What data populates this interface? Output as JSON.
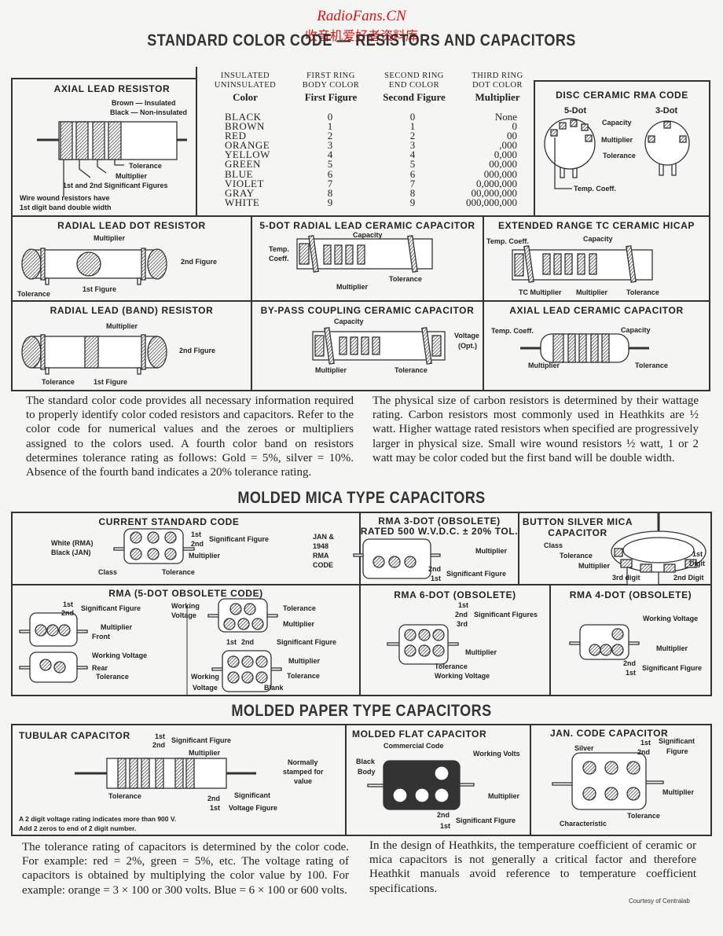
{
  "watermark": {
    "site": "RadioFans.CN",
    "subtitle": "收音机爱好者资料库"
  },
  "title": "STANDARD COLOR CODE — RESISTORS AND CAPACITORS",
  "color_table": {
    "headers": [
      {
        "line1": "INSULATED",
        "line2": "UNINSULATED",
        "line3": "Color"
      },
      {
        "line1": "FIRST RING",
        "line2": "BODY COLOR",
        "line3": "First Figure"
      },
      {
        "line1": "SECOND RING",
        "line2": "END COLOR",
        "line3": "Second Figure"
      },
      {
        "line1": "THIRD RING",
        "line2": "DOT COLOR",
        "line3": "Multiplier"
      }
    ],
    "colors": [
      "BLACK",
      "BROWN",
      "RED",
      "ORANGE",
      "YELLOW",
      "GREEN",
      "BLUE",
      "VIOLET",
      "GRAY",
      "WHITE"
    ],
    "first": [
      "0",
      "1",
      "2",
      "3",
      "4",
      "5",
      "6",
      "7",
      "8",
      "9"
    ],
    "second": [
      "0",
      "1",
      "2",
      "3",
      "4",
      "5",
      "6",
      "7",
      "8",
      "9"
    ],
    "multiplier": [
      "None",
      "0",
      "00",
      ",000",
      "0,000",
      "00,000",
      "000,000",
      "0,000,000",
      "00,000,000",
      "000,000,000"
    ]
  },
  "axial_resistor": {
    "title": "AXIAL LEAD RESISTOR",
    "labels": [
      "Brown — Insulated",
      "Black —  Non-insulated",
      "Tolerance",
      "Multiplier",
      "1st and 2nd Significant Figures",
      "Wire wound resistors have",
      "1st digit band double width"
    ]
  },
  "disc_ceramic": {
    "title": "DISC CERAMIC RMA CODE",
    "labels": [
      "5-Dot",
      "3-Dot",
      "Capacity",
      "Multiplier",
      "Tolerance",
      "Temp. Coeff."
    ]
  },
  "radial_dot_resistor": {
    "title": "RADIAL LEAD DOT RESISTOR",
    "labels": [
      "Multiplier",
      "2nd Figure",
      "1st Figure",
      "Tolerance"
    ]
  },
  "five_dot_radial": {
    "title": "5-DOT RADIAL LEAD CERAMIC CAPACITOR",
    "labels": [
      "Capacity",
      "Temp.",
      "Coeff.",
      "Multiplier",
      "Tolerance"
    ]
  },
  "extended_range": {
    "title": "EXTENDED RANGE TC CERAMIC  HICAP",
    "labels": [
      "Temp. Coeff.",
      "Capacity",
      "TC Multiplier",
      "Multiplier",
      "Tolerance"
    ]
  },
  "radial_band_resistor": {
    "title": "RADIAL LEAD (BAND) RESISTOR",
    "labels": [
      "Multiplier",
      "2nd Figure",
      "Tolerance",
      "1st Figure"
    ]
  },
  "bypass_ceramic": {
    "title": "BY-PASS COUPLING CERAMIC  CAPACITOR",
    "labels": [
      "Capacity",
      "Voltage",
      "(Opt.)",
      "Multiplier",
      "Tolerance"
    ]
  },
  "axial_ceramic": {
    "title": "AXIAL LEAD CERAMIC CAPACITOR",
    "labels": [
      "Temp. Coeff.",
      "Capacity",
      "Multiplier",
      "Tolerance"
    ]
  },
  "intro_paragraphs": [
    "The standard color code provides all necessary information required to properly identify color coded resistors and capacitors. Refer to the color code for numerical values and the zeroes or multipliers assigned to the colors used. A fourth color band on resistors determines tolerance rating as follows: Gold = 5%, silver = 10%. Absence of the fourth band indicates a 20% tolerance rating.",
    "The physical size of carbon resistors is determined by their wattage rating. Carbon resistors most commonly used in Heathkits are ½ watt. Higher wattage rated resistors when specified are progressively larger in physical size. Small wire wound resistors ½ watt, 1 or 2 watt may be color coded but the first band will be double width."
  ],
  "mica_heading": "MOLDED MICA TYPE CAPACITORS",
  "current_standard": {
    "title": "CURRENT STANDARD CODE",
    "labels": [
      "White (RMA)",
      "Black (JAN)",
      "1st",
      "2nd",
      "Significant Figure",
      "Multiplier",
      "Class",
      "Tolerance",
      "JAN &",
      "1948",
      "RMA",
      "CODE"
    ]
  },
  "rma_3dot": {
    "title": "RMA 3-DOT (OBSOLETE)",
    "subtitle": "RATED 500 W.V.D.C. ± 20% TOL.",
    "labels": [
      "Multiplier",
      "2nd",
      "1st",
      "Significant Figure"
    ]
  },
  "button_mica": {
    "title": "BUTTON SILVER MICA",
    "subtitle": "CAPACITOR",
    "labels": [
      "Class",
      "Tolerance",
      "Multiplier",
      "3rd digit",
      "2nd Digit",
      "1st",
      "Digit"
    ]
  },
  "rma_5dot": {
    "title": "RMA (5-DOT OBSOLETE CODE)",
    "labels": [
      "1st",
      "2nd",
      "Significant Figure",
      "Multiplier",
      "Front",
      "Working  Voltage",
      "Rear",
      "Tolerance",
      "Working",
      "Voltage",
      "Tolerance",
      "Multiplier",
      "1st",
      "2nd",
      "Significant Figure",
      "Multiplier",
      "Tolerance",
      "Working",
      "Voltage",
      "Blank"
    ]
  },
  "rma_6dot": {
    "title": "RMA 6-DOT (OBSOLETE)",
    "labels": [
      "1st",
      "2nd",
      "3rd",
      "Significant Figures",
      "Multiplier",
      "Tolerance",
      "Working Voltage"
    ]
  },
  "rma_4dot": {
    "title": "RMA 4-DOT (OBSOLETE)",
    "labels": [
      "Working Voltage",
      "Multiplier",
      "2nd",
      "1st",
      "Significant Figure"
    ]
  },
  "paper_heading": "MOLDED PAPER TYPE CAPACITORS",
  "tubular": {
    "title": "TUBULAR CAPACITOR",
    "labels": [
      "1st",
      "2nd",
      "Significant Figure",
      "Multiplier",
      "Normally",
      "stamped for",
      "value",
      "Tolerance",
      "2nd",
      "1st",
      "Significant",
      "Voltage Figure",
      "A 2 digit voltage rating indicates more than 900 V.",
      "Add 2 zeros to end of 2 digit number."
    ]
  },
  "molded_flat": {
    "title": "MOLDED FLAT  CAPACITOR",
    "labels": [
      "Commercial Code",
      "Working Volts",
      "Black",
      "Body",
      "Multiplier",
      "2nd",
      "1st",
      "Significant Figure"
    ]
  },
  "jan_code": {
    "title": "JAN. CODE CAPACITOR",
    "labels": [
      "Silver",
      "1st",
      "2nd",
      "Significant",
      "Figure",
      "Multiplier",
      "Tolerance",
      "Characteristic"
    ]
  },
  "closing_paragraphs": [
    "The tolerance rating of capacitors is determined by the color code. For example: red = 2%, green = 5%, etc. The voltage rating of capacitors is obtained by multiplying the color value by 100. For example: orange = 3 × 100 or 300 volts. Blue = 6 × 100 or 600 volts.",
    "In the design of Heathkits, the temperature coefficient of ceramic or mica capacitors is not generally a critical factor and therefore Heathkit manuals avoid reference to temperature coefficient specifications."
  ],
  "courtesy": "Courtesy of Centralab",
  "colors": {
    "ink": "#222222",
    "paper": "#f5f5f3",
    "watermark": "#e01010"
  }
}
